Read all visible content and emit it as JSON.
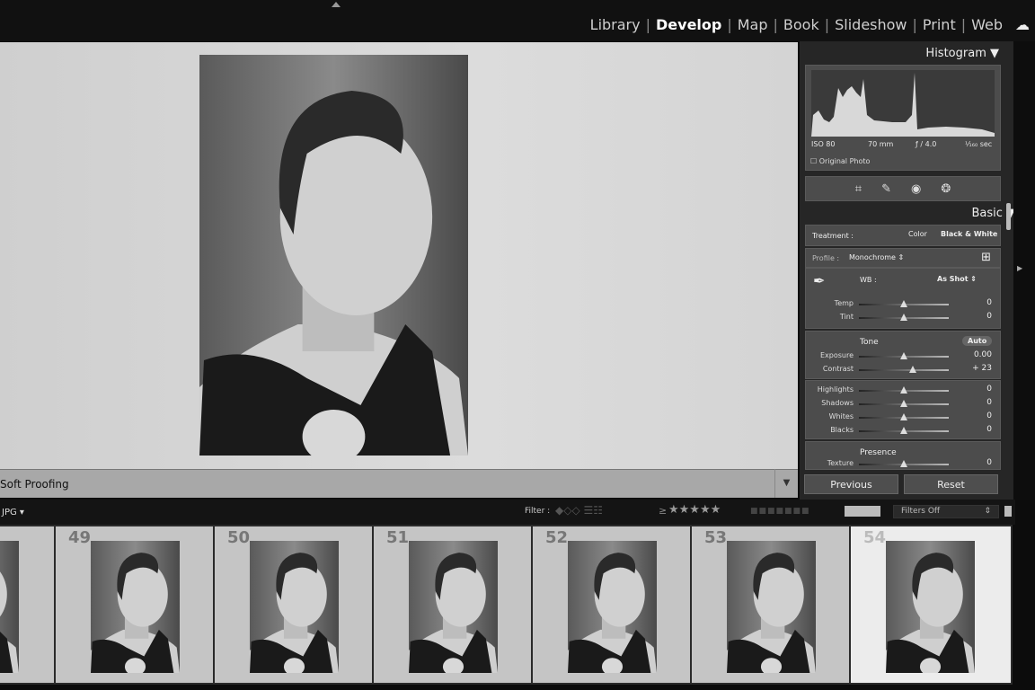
{
  "modules": [
    "Library",
    "Develop",
    "Map",
    "Book",
    "Slideshow",
    "Print",
    "Web"
  ],
  "active_module": "Develop",
  "toolbar": {
    "soft_proofing": "Soft Proofing"
  },
  "histogram": {
    "title": "Histogram",
    "iso": "ISO 80",
    "focal": "70 mm",
    "aperture": "ƒ / 4.0",
    "shutter": "¹⁄₁₆₀ sec",
    "original_photo": "Original Photo"
  },
  "basic": {
    "title": "Basic",
    "treatment_label": "Treatment :",
    "treatment_color": "Color",
    "treatment_bw": "Black & White",
    "profile_label": "Profile :",
    "profile_value": "Monochrome",
    "wb_label": "WB :",
    "wb_value": "As Shot",
    "tone_label": "Tone",
    "auto": "Auto",
    "presence_label": "Presence",
    "sliders": [
      {
        "label": "Temp",
        "value": "0",
        "pos": 0.5
      },
      {
        "label": "Tint",
        "value": "0",
        "pos": 0.5
      },
      {
        "label": "Exposure",
        "value": "0.00",
        "pos": 0.5
      },
      {
        "label": "Contrast",
        "value": "+ 23",
        "pos": 0.6
      },
      {
        "label": "Highlights",
        "value": "0",
        "pos": 0.5
      },
      {
        "label": "Shadows",
        "value": "0",
        "pos": 0.5
      },
      {
        "label": "Whites",
        "value": "0",
        "pos": 0.5
      },
      {
        "label": "Blacks",
        "value": "0",
        "pos": 0.5
      },
      {
        "label": "Texture",
        "value": "0",
        "pos": 0.5
      }
    ]
  },
  "buttons": {
    "previous": "Previous",
    "reset": "Reset"
  },
  "filmstrip": {
    "source": "JPG ▾",
    "filter_label": "Filter :",
    "rating_op": "≥",
    "stars": "★★★★★",
    "filters_value": "Filters Off",
    "frames": [
      {
        "n": "49"
      },
      {
        "n": "50"
      },
      {
        "n": "51"
      },
      {
        "n": "52"
      },
      {
        "n": "53"
      },
      {
        "n": "54",
        "selected": true
      }
    ]
  }
}
